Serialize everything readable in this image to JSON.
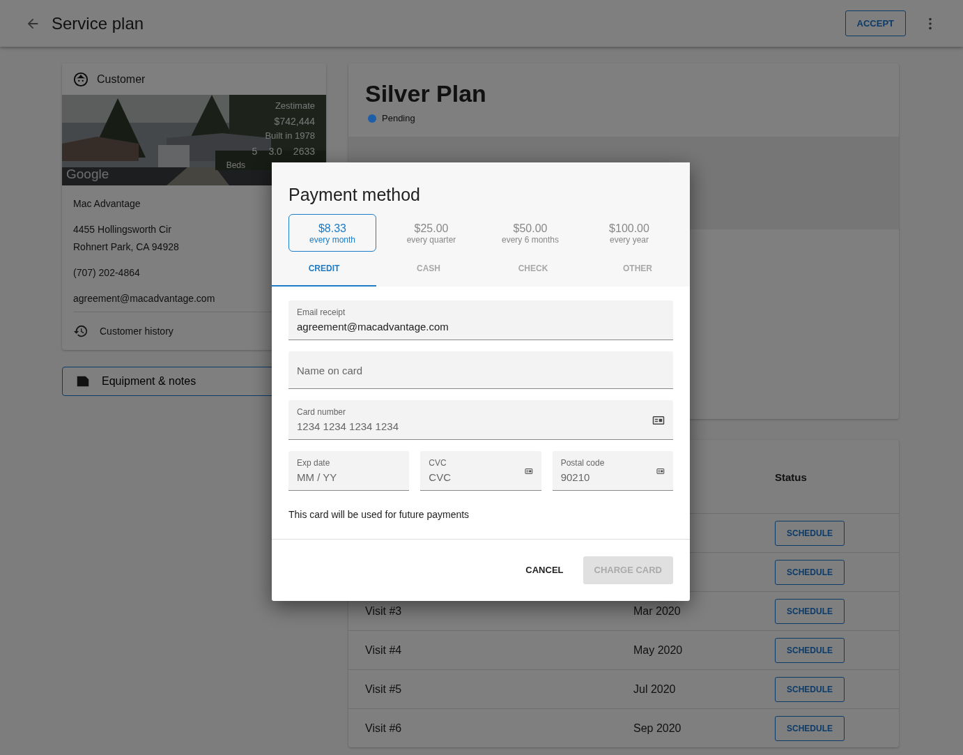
{
  "header": {
    "title": "Service plan",
    "accept": "ACCEPT"
  },
  "customer": {
    "title": "Customer",
    "photo": {
      "kind": "picture",
      "zestimate_label": "Zestimate",
      "zestimate": "$742,444",
      "built": "Built in 1978",
      "beds": "5",
      "beds_label": "Beds",
      "baths": "3.0",
      "sqft": "2633",
      "credit": "Google"
    },
    "name": "Mac Advantage",
    "address_lines": [
      "4455 Hollingsworth Cir",
      "Rohnert Park, CA 94928"
    ],
    "phone": "(707) 202-4864",
    "email": "agreement@macadvantage.com",
    "history": "Customer history"
  },
  "equipment_button": "Equipment & notes",
  "plan": {
    "title": "Silver Plan",
    "status": {
      "label": "Pending",
      "color": "#1c5ea8"
    }
  },
  "visits": {
    "status_column": "Status",
    "rows": [
      {
        "status": "SCHEDULE"
      },
      {
        "status": "SCHEDULE"
      },
      {
        "visit": "Visit #3",
        "date": "Mar 2020",
        "status": "SCHEDULE"
      },
      {
        "visit": "Visit #4",
        "date": "May 2020",
        "status": "SCHEDULE"
      },
      {
        "visit": "Visit #5",
        "date": "Jul 2020",
        "status": "SCHEDULE"
      },
      {
        "visit": "Visit #6",
        "date": "Sep 2020",
        "status": "SCHEDULE"
      }
    ]
  },
  "dialog": {
    "title": "Payment method",
    "prices": [
      {
        "amount": "$8.33",
        "period": "every month",
        "selected": true
      },
      {
        "amount": "$25.00",
        "period": "every quarter",
        "selected": false
      },
      {
        "amount": "$50.00",
        "period": "every 6 months",
        "selected": false
      },
      {
        "amount": "$100.00",
        "period": "every year",
        "selected": false
      }
    ],
    "tabs": [
      {
        "label": "CREDIT",
        "selected": true,
        "disabled": false
      },
      {
        "label": "CASH",
        "selected": false,
        "disabled": true
      },
      {
        "label": "CHECK",
        "selected": false,
        "disabled": true
      },
      {
        "label": "OTHER",
        "selected": false,
        "disabled": true
      }
    ],
    "fields": [
      {
        "label": "Email receipt",
        "value": "agreement@macadvantage.com"
      },
      {
        "placeholder": "Name on card"
      },
      {
        "label": "Card number",
        "placeholder": "1234 1234 1234 1234",
        "card_icon": true
      }
    ],
    "small_fields": [
      {
        "label": "Exp date",
        "placeholder": "MM / YY",
        "card_icon": false
      },
      {
        "label": "CVC",
        "placeholder": "CVC",
        "card_icon": true
      },
      {
        "label": "Postal code",
        "placeholder": "90210",
        "card_icon": true
      }
    ],
    "note": "This card will be used for future payments",
    "cancel": "CANCEL",
    "charge": {
      "label": "CHARGE CARD",
      "disabled": true
    }
  }
}
